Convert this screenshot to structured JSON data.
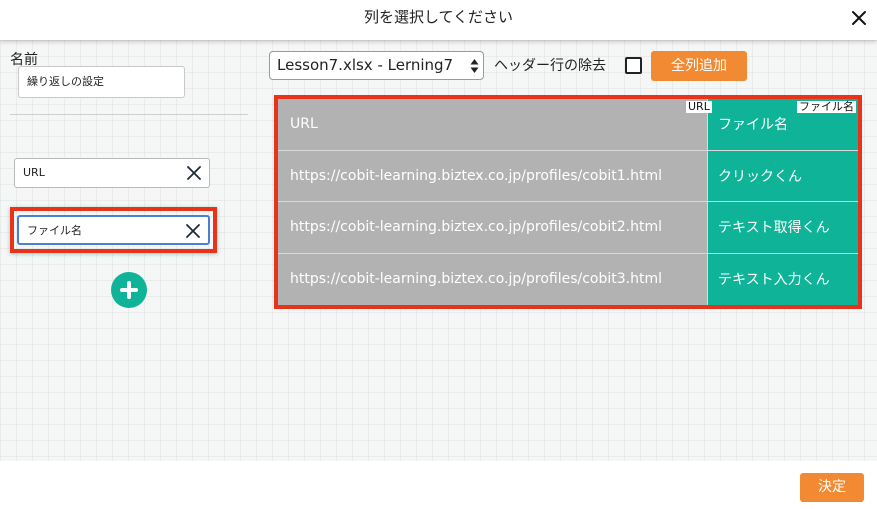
{
  "dialog": {
    "title": "列を選択してください",
    "close_icon": "close-icon"
  },
  "left_panel": {
    "name_label": "名前",
    "name_value": "繰り返しの設定",
    "fields": [
      {
        "value": "URL",
        "remove_icon": "close-icon"
      },
      {
        "value": "ファイル名",
        "remove_icon": "close-icon",
        "focused": true
      }
    ],
    "add_icon": "plus-icon"
  },
  "toolbar": {
    "sheet_selected": "Lesson7.xlsx - Lerning7",
    "header_row_label": "ヘッダー行の除去",
    "header_row_checked": false,
    "add_all_label": "全列追加"
  },
  "table": {
    "column_tags": [
      "URL",
      "ファイル名"
    ],
    "rows": [
      [
        "URL",
        "ファイル名"
      ],
      [
        "https://cobit-learning.biztex.co.jp/profiles/cobit1.html",
        "クリックくん"
      ],
      [
        "https://cobit-learning.biztex.co.jp/profiles/cobit2.html",
        "テキスト取得くん"
      ],
      [
        "https://cobit-learning.biztex.co.jp/profiles/cobit3.html",
        "テキスト入力くん"
      ]
    ]
  },
  "footer": {
    "confirm_label": "決定"
  },
  "colors": {
    "accent_orange": "#f18a33",
    "teal": "#0fb498",
    "highlight_red": "#e8331a",
    "gray_column": "#b2b2b2"
  }
}
